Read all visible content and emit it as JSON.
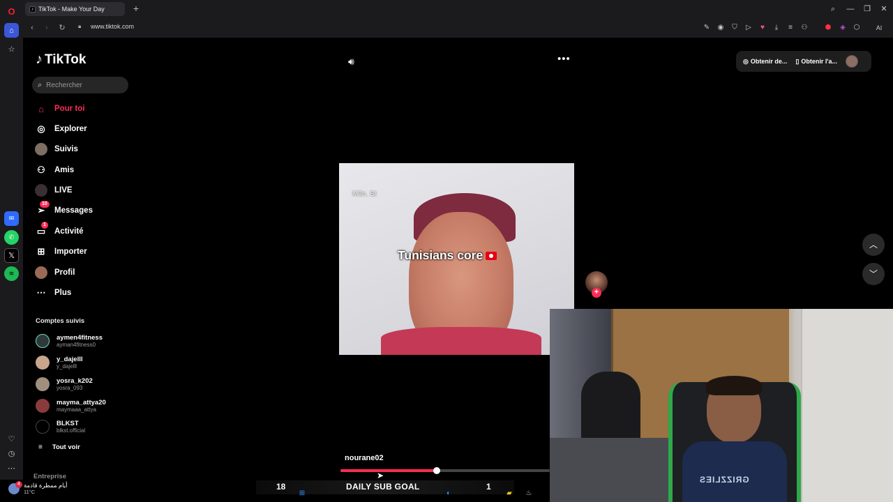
{
  "browser": {
    "tab_title": "TikTok - Make Your Day",
    "url": "www.tiktok.com",
    "ai_label": "AI"
  },
  "sidebar_brand": "TikTok",
  "search": {
    "placeholder": "Rechercher"
  },
  "nav": [
    {
      "label": "Pour toi",
      "icon": "home-icon",
      "active": true
    },
    {
      "label": "Explorer",
      "icon": "compass-icon"
    },
    {
      "label": "Suivis",
      "icon": "following-avatar-icon"
    },
    {
      "label": "Amis",
      "icon": "friends-icon"
    },
    {
      "label": "LIVE",
      "icon": "live-icon"
    },
    {
      "label": "Messages",
      "icon": "messages-icon",
      "badge": "10"
    },
    {
      "label": "Activité",
      "icon": "activity-icon",
      "badge": "1"
    },
    {
      "label": "Importer",
      "icon": "upload-icon"
    },
    {
      "label": "Profil",
      "icon": "profile-icon"
    },
    {
      "label": "Plus",
      "icon": "more-icon"
    }
  ],
  "following": {
    "title": "Comptes suivis",
    "accounts": [
      {
        "name": "aymen4fitness",
        "handle": "ayman4fitness0"
      },
      {
        "name": "y_dajelll",
        "handle": "y_dajelll"
      },
      {
        "name": "yosra_k202",
        "handle": "yosra_093"
      },
      {
        "name": "mayma_attya20",
        "handle": "maymaaa_attya"
      },
      {
        "name": "BLKST",
        "handle": "blkst.official"
      }
    ],
    "see_all": "Tout voir"
  },
  "footer_section": "Entreprise",
  "top_right": {
    "coins_label": "Obtenir de...",
    "app_label": "Obtenir l'a..."
  },
  "video": {
    "watermark": "M3n. St",
    "caption": "Tunisians core",
    "creator": "nourane02",
    "progress": 0.46
  },
  "overlay": {
    "weather_text": "أيام ممطرة قادمة",
    "weather_temp": "11°C",
    "weather_badge": "4",
    "goal_left": "18",
    "goal_title": "DAILY SUB GOAL",
    "goal_right": "1"
  },
  "webcam": {
    "jersey_text": "GRIZZLIES"
  },
  "colors": {
    "accent": "#fe2c55",
    "background": "#000000",
    "browser_chrome": "#1b1b1e"
  }
}
